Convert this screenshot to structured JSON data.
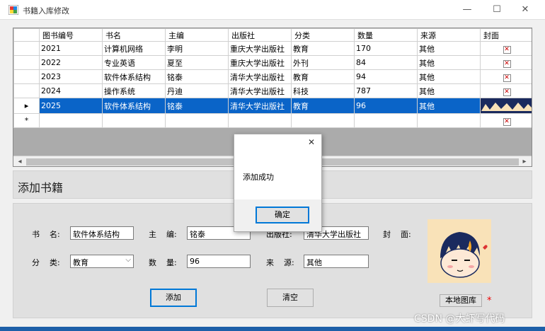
{
  "window": {
    "title": "书籍入库修改",
    "minimize_glyph": "—",
    "maximize_glyph": "☐",
    "close_glyph": "✕"
  },
  "grid": {
    "columns": [
      "图书编号",
      "书名",
      "主编",
      "出版社",
      "分类",
      "数量",
      "来源",
      "封面"
    ],
    "rows": [
      {
        "marker": "",
        "cells": [
          "2021",
          "计算机网络",
          "李明",
          "重庆大学出版社",
          "教育",
          "170",
          "其他"
        ],
        "cover": "x-icon"
      },
      {
        "marker": "",
        "cells": [
          "2022",
          "专业英语",
          "夏至",
          "重庆大学出版社",
          "外刊",
          "84",
          "其他"
        ],
        "cover": "x-icon"
      },
      {
        "marker": "",
        "cells": [
          "2023",
          "软件体系结构",
          "铭泰",
          "清华大学出版社",
          "教育",
          "94",
          "其他"
        ],
        "cover": "x-icon"
      },
      {
        "marker": "",
        "cells": [
          "2024",
          "操作系统",
          "丹迪",
          "清华大学出版社",
          "科技",
          "787",
          "其他"
        ],
        "cover": "x-icon"
      },
      {
        "marker": "▸",
        "cells": [
          "2025",
          "软件体系结构",
          "铭泰",
          "清华大学出版社",
          "教育",
          "96",
          "其他"
        ],
        "cover": "image",
        "selected": true
      },
      {
        "marker": "*",
        "cells": [
          "",
          "",
          "",
          "",
          "",
          "",
          ""
        ],
        "cover": "x-icon"
      }
    ]
  },
  "section_title": "添加书籍",
  "form": {
    "name_label": "书    名:",
    "name_value": "软件体系结构",
    "editor_label": "主    编:",
    "editor_value": "铭泰",
    "publisher_label": "出版社:",
    "publisher_value": "清华大学出版社",
    "cover_label": "封    面:",
    "category_label": "分    类:",
    "category_value": "教育",
    "quantity_label": "数    量:",
    "quantity_value": "96",
    "source_label": "来    源:",
    "source_value": "其他",
    "add_button": "添加",
    "clear_button": "清空",
    "gallery_button": "本地图库",
    "required_mark": "*"
  },
  "dialog": {
    "message": "添加成功",
    "ok_button": "确定",
    "close_glyph": "✕"
  },
  "watermark": "CSDN @大虾写代码",
  "colors": {
    "selection": "#0a64c8",
    "accent": "#0078d7",
    "required": "#ee0000"
  }
}
